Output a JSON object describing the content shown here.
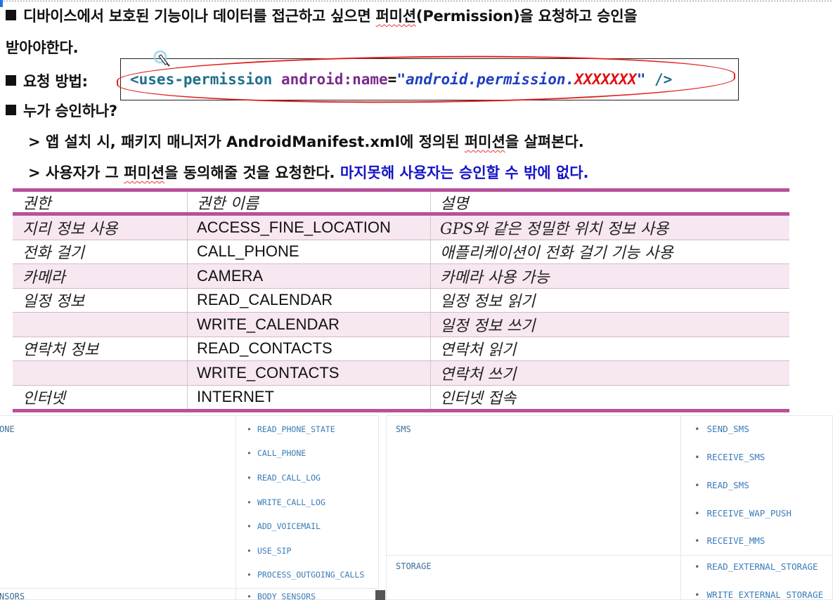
{
  "intro": {
    "line1_pre": "디바이스에서 보호된 기능이나 데이터를 접근하고 싶으면 ",
    "line1_squig": "퍼미션",
    "line1_post": "(Permission)을 요청하고 승인을",
    "line2": "받아야한다.",
    "request_label": "요청 방법:",
    "who_label": "누가 승인하나?"
  },
  "code": {
    "tag_open": "<uses-permission",
    "attr": "android:name",
    "eq": "=",
    "str": "\"android.permission.",
    "red": "XXXXXXX",
    "quote_close": "\"",
    "tag_close": "/>"
  },
  "bullets": {
    "b1_pre": "> 앱 설치 시, 패키지 매니저가 AndroidManifest.xml에 정의된 ",
    "b1_squig": "퍼미션",
    "b1_post": "을 살펴본다.",
    "b2_pre": "> 사용자가 그 ",
    "b2_squig": "퍼미션",
    "b2_post": "을 동의해줄 것을 요청한다. ",
    "b2_blue": "마지못해 사용자는 승인할 수 밖에 없다."
  },
  "table": {
    "headers": [
      "권한",
      "권한 이름",
      "설명"
    ],
    "rows": [
      {
        "group": "지리 정보 사용",
        "name": "ACCESS_FINE_LOCATION",
        "desc": "GPS와 같은 정밀한 위치 정보 사용"
      },
      {
        "group": "전화 걸기",
        "name": "CALL_PHONE",
        "desc": "애플리케이션이 전화 걸기 기능 사용"
      },
      {
        "group": "카메라",
        "name": "CAMERA",
        "desc": "카메라 사용 가능"
      },
      {
        "group": "일정 정보",
        "name": "READ_CALENDAR",
        "desc": "일정 정보 읽기"
      },
      {
        "group": "",
        "name": "WRITE_CALENDAR",
        "desc": "일정 정보 쓰기"
      },
      {
        "group": "연락처 정보",
        "name": "READ_CONTACTS",
        "desc": "연락처 읽기"
      },
      {
        "group": "",
        "name": "WRITE_CONTACTS",
        "desc": "연락처 쓰기"
      },
      {
        "group": "인터넷",
        "name": "INTERNET",
        "desc": "인터넷 접속"
      }
    ]
  },
  "lower_left": {
    "group_top": "ONE",
    "group_bottom": "NSORS",
    "items": [
      "READ_PHONE_STATE",
      "CALL_PHONE",
      "READ_CALL_LOG",
      "WRITE_CALL_LOG",
      "ADD_VOICEMAIL",
      "USE_SIP",
      "PROCESS_OUTGOING_CALLS",
      "BODY_SENSORS"
    ]
  },
  "lower_right": {
    "group_sms": "SMS",
    "sms_items": [
      "SEND_SMS",
      "RECEIVE_SMS",
      "READ_SMS",
      "RECEIVE_WAP_PUSH",
      "RECEIVE_MMS"
    ],
    "group_storage": "STORAGE",
    "storage_items": [
      "READ_EXTERNAL_STORAGE",
      "WRITE_EXTERNAL_STORAGE"
    ]
  },
  "bullet_char": "•"
}
